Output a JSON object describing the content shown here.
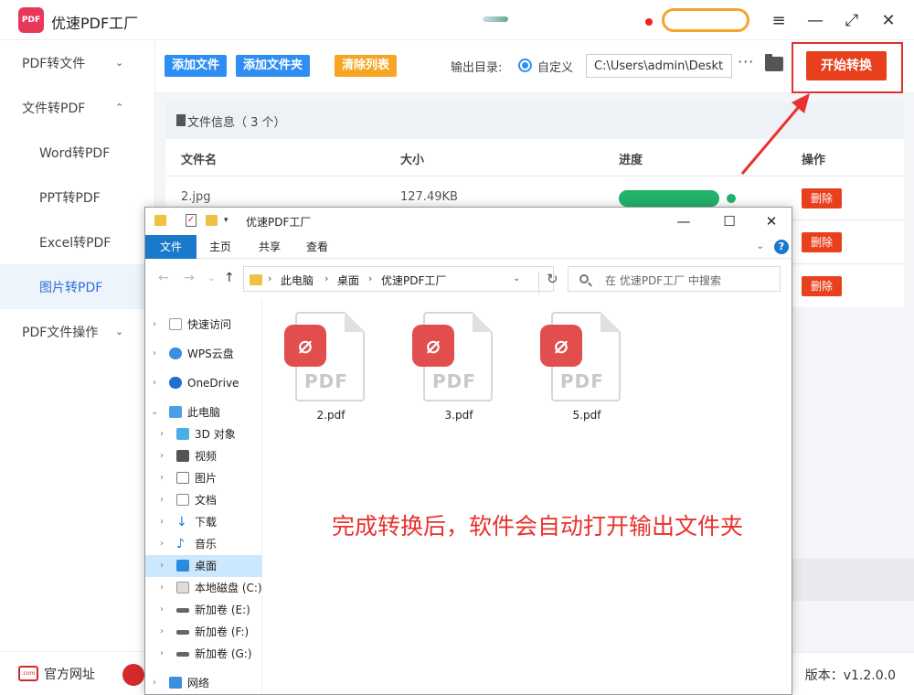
{
  "app": {
    "title": "优速PDF工厂",
    "logo_text": "PDF",
    "window_controls": {
      "menu": "≡",
      "minimize": "—",
      "maximize": "⤢",
      "close": "✕"
    }
  },
  "sidebar": {
    "items": [
      {
        "label": "PDF转文件",
        "chev": "⌄"
      },
      {
        "label": "文件转PDF",
        "chev": "⌃"
      },
      {
        "label": "Word转PDF"
      },
      {
        "label": "PPT转PDF"
      },
      {
        "label": "Excel转PDF"
      },
      {
        "label": "图片转PDF"
      },
      {
        "label": "PDF文件操作",
        "chev": "⌄"
      }
    ],
    "footer": {
      "site_label": "官方网址",
      "site_icon_text": ".com"
    }
  },
  "toolbar": {
    "add_file": "添加文件",
    "add_folder": "添加文件夹",
    "clear_list": "清除列表",
    "output_label": "输出目录:",
    "custom_label": "自定义",
    "output_path": "C:\\Users\\admin\\Deskto",
    "more": "···",
    "start": "开始转换"
  },
  "file_info": {
    "label": "文件信息（ 3 个）"
  },
  "table": {
    "headers": [
      "文件名",
      "大小",
      "进度",
      "操作"
    ],
    "rows": [
      {
        "name": "2.jpg",
        "size": "127.49KB",
        "progress": 1.0,
        "action": "删除"
      },
      {
        "name": "",
        "size": "",
        "progress": 1.0,
        "action": "删除"
      },
      {
        "name": "",
        "size": "",
        "progress": 1.0,
        "action": "删除"
      }
    ]
  },
  "version": "版本：v1.2.0.0",
  "explorer": {
    "title": "优速PDF工厂",
    "ribbon_tabs": [
      "文件",
      "主页",
      "共享",
      "查看"
    ],
    "help": "?",
    "breadcrumb": [
      "此电脑",
      "桌面",
      "优速PDF工厂"
    ],
    "search_placeholder": "在 优速PDF工厂 中搜索",
    "nav": [
      {
        "label": "快速访问",
        "icon": "quick-access-icon"
      },
      {
        "label": "WPS云盘",
        "icon": "cloud-icon"
      },
      {
        "label": "OneDrive",
        "icon": "onedrive-icon"
      },
      {
        "label": "此电脑",
        "icon": "computer-icon"
      },
      {
        "label": "3D 对象",
        "icon": "3d-objects-icon"
      },
      {
        "label": "视频",
        "icon": "video-icon"
      },
      {
        "label": "图片",
        "icon": "pictures-icon"
      },
      {
        "label": "文档",
        "icon": "documents-icon"
      },
      {
        "label": "下载",
        "icon": "download-icon"
      },
      {
        "label": "音乐",
        "icon": "music-icon"
      },
      {
        "label": "桌面",
        "icon": "desktop-icon"
      },
      {
        "label": "本地磁盘 (C:)",
        "icon": "drive-icon"
      },
      {
        "label": "新加卷 (E:)",
        "icon": "drive-icon"
      },
      {
        "label": "新加卷 (F:)",
        "icon": "drive-icon"
      },
      {
        "label": "新加卷 (G:)",
        "icon": "drive-icon"
      },
      {
        "label": "网络",
        "icon": "network-icon"
      }
    ],
    "files": [
      {
        "name": "2.pdf",
        "type_label": "PDF"
      },
      {
        "name": "3.pdf",
        "type_label": "PDF"
      },
      {
        "name": "5.pdf",
        "type_label": "PDF"
      }
    ]
  },
  "annotation_text": "完成转换后，软件会自动打开输出文件夹",
  "colors": {
    "accent_blue": "#2f8ef2",
    "accent_orange": "#f6a623",
    "start_red": "#e8401c",
    "progress_green": "#22b26a",
    "annotation_red": "#e8322e"
  }
}
